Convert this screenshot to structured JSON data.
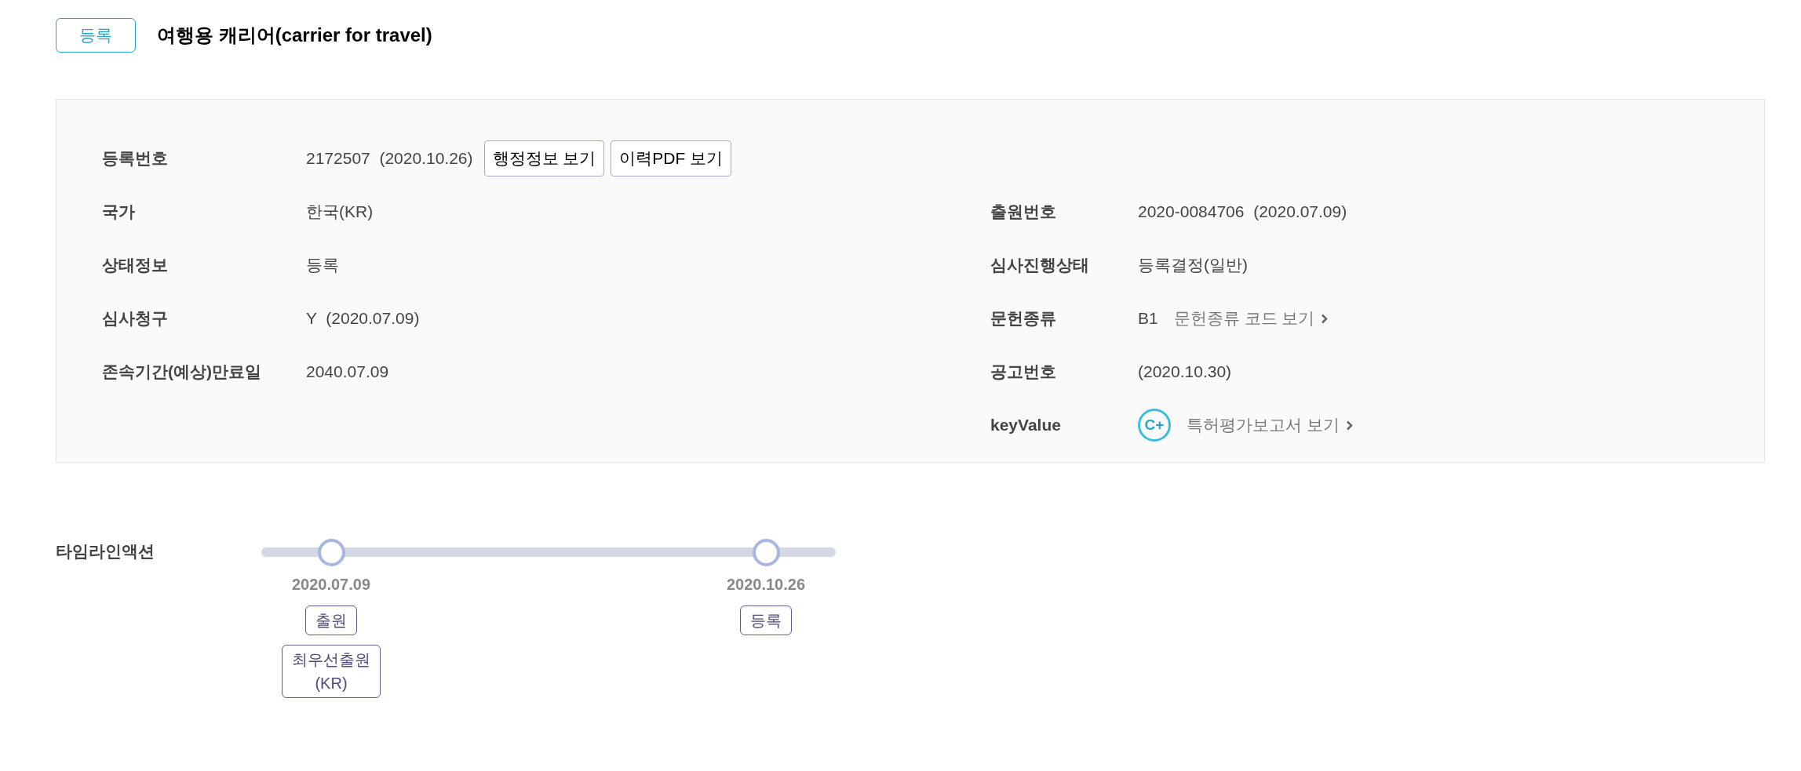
{
  "header": {
    "status_badge": "등록",
    "title": "여행용 캐리어(carrier for travel)"
  },
  "details": {
    "left": [
      {
        "label": "등록번호",
        "value": "2172507  (2020.10.26)",
        "buttons": [
          "행정정보 보기",
          "이력PDF 보기"
        ]
      },
      {
        "label": "국가",
        "value": "한국(KR)"
      },
      {
        "label": "상태정보",
        "value": "등록"
      },
      {
        "label": "심사청구",
        "value": "Y  (2020.07.09)"
      },
      {
        "label": "존속기간(예상)만료일",
        "value": "2040.07.09"
      }
    ],
    "right": [
      {
        "label": "출원번호",
        "value": "2020-0084706  (2020.07.09)"
      },
      {
        "label": "심사진행상태",
        "value": "등록결정(일반)"
      },
      {
        "label": "문헌종류",
        "value": "B1",
        "link": "문헌종류 코드 보기"
      },
      {
        "label": "공고번호",
        "value": "(2020.10.30)"
      },
      {
        "label": "keyValue",
        "grade": "C+",
        "link": "특허평가보고서 보기"
      }
    ]
  },
  "timeline": {
    "label": "타임라인액션",
    "events": [
      {
        "date": "2020.07.09",
        "tags": [
          [
            "출원"
          ],
          [
            "최우선출원",
            "(KR)"
          ]
        ]
      },
      {
        "date": "2020.10.26",
        "tags": [
          [
            "등록"
          ]
        ]
      }
    ]
  }
}
